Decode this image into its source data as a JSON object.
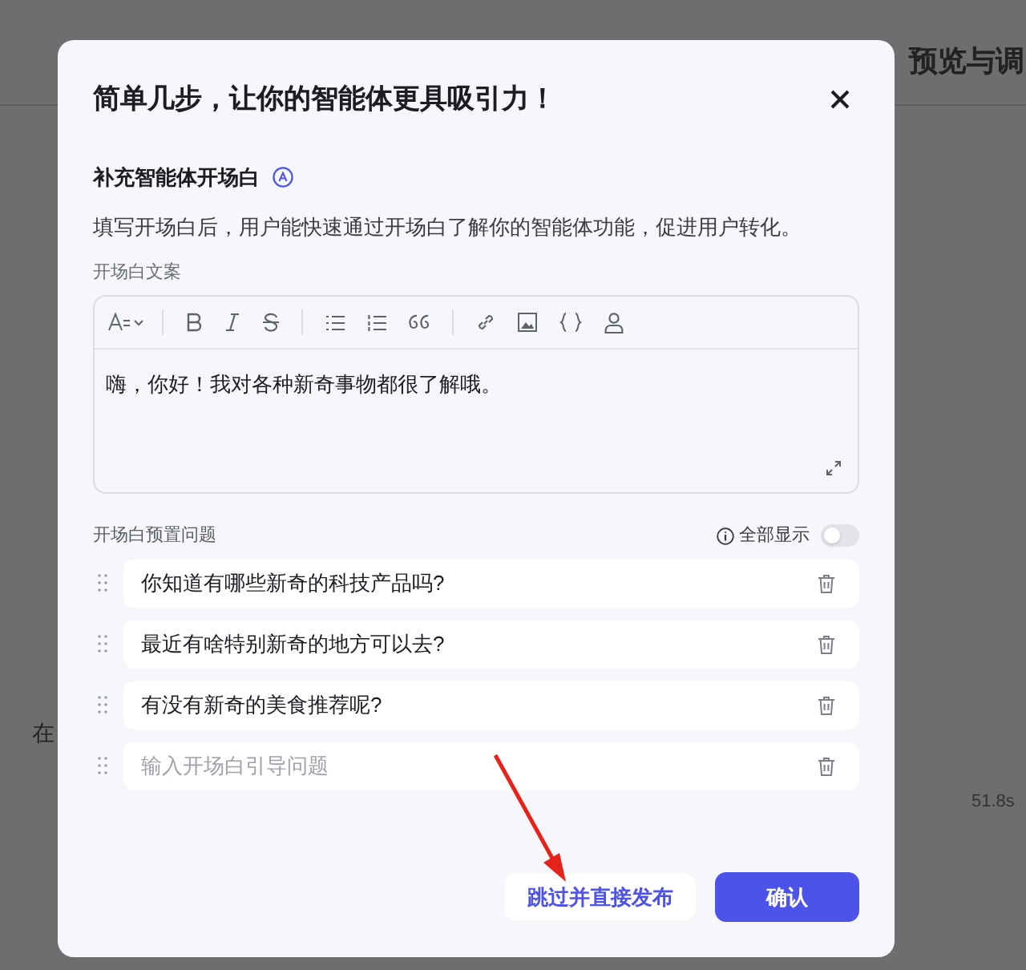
{
  "background": {
    "title": "预览与调",
    "side_text": "在",
    "timing": "51.8s"
  },
  "dialog": {
    "title": "简单几步，让你的智能体更具吸引力！",
    "section": {
      "title": "补充智能体开场白",
      "description": "填写开场白后，用户能快速通过开场白了解你的智能体功能，促进用户转化。"
    },
    "editor": {
      "label": "开场白文案",
      "value": "嗨，你好！我对各种新奇事物都很了解哦。"
    },
    "questions": {
      "label": "开场白预置问题",
      "show_all": {
        "label": "全部显示",
        "on": false
      },
      "items": [
        {
          "value": "你知道有哪些新奇的科技产品吗?"
        },
        {
          "value": "最近有啥特别新奇的地方可以去?"
        },
        {
          "value": "有没有新奇的美食推荐呢?"
        },
        {
          "placeholder": "输入开场白引导问题"
        }
      ]
    },
    "buttons": [
      {
        "label": "跳过并直接发布",
        "kind": "secondary"
      },
      {
        "label": "确认",
        "kind": "primary"
      }
    ]
  }
}
